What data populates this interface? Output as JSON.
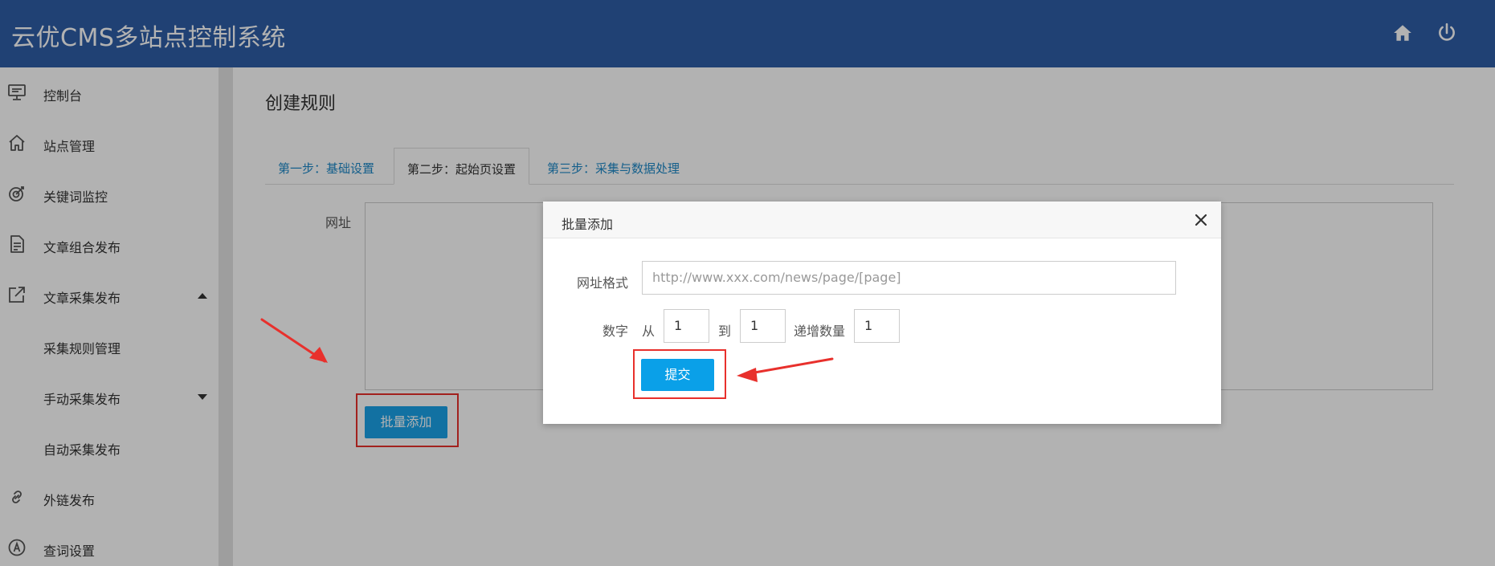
{
  "header": {
    "title": "云优CMS多站点控制系统",
    "home_icon": "home-icon",
    "power_icon": "power-icon"
  },
  "sidebar": {
    "items": [
      {
        "label": "控制台",
        "icon": "monitor-icon"
      },
      {
        "label": "站点管理",
        "icon": "home-icon"
      },
      {
        "label": "关键词监控",
        "icon": "target-icon"
      },
      {
        "label": "文章组合发布",
        "icon": "document-icon"
      },
      {
        "label": "文章采集发布",
        "icon": "external-link-icon",
        "caret": "up"
      },
      {
        "label": "采集规则管理"
      },
      {
        "label": "手动采集发布",
        "caret": "down"
      },
      {
        "label": "自动采集发布"
      },
      {
        "label": "外链发布",
        "icon": "link-icon"
      },
      {
        "label": "查词设置",
        "icon": "at-icon"
      }
    ]
  },
  "main": {
    "title": "创建规则",
    "tabs": [
      {
        "label": "第一步：基础设置"
      },
      {
        "label": "第二步：起始页设置",
        "active": true
      },
      {
        "label": "第三步：采集与数据处理"
      }
    ],
    "url_label": "网址",
    "batch_add_label": "批量添加"
  },
  "modal": {
    "title": "批量添加",
    "url_format_label": "网址格式",
    "url_format_placeholder": "http://www.xxx.com/news/page/[page]",
    "number_label": "数字",
    "from_label": "从",
    "from_value": "1",
    "to_label": "到",
    "to_value": "1",
    "step_label": "递增数量",
    "step_value": "1",
    "submit_label": "提交"
  },
  "colors": {
    "header_bg": "#2f5ea7",
    "button": "#1ba2e8",
    "annotation": "#e8302c",
    "tab_link": "#1e88c7"
  }
}
